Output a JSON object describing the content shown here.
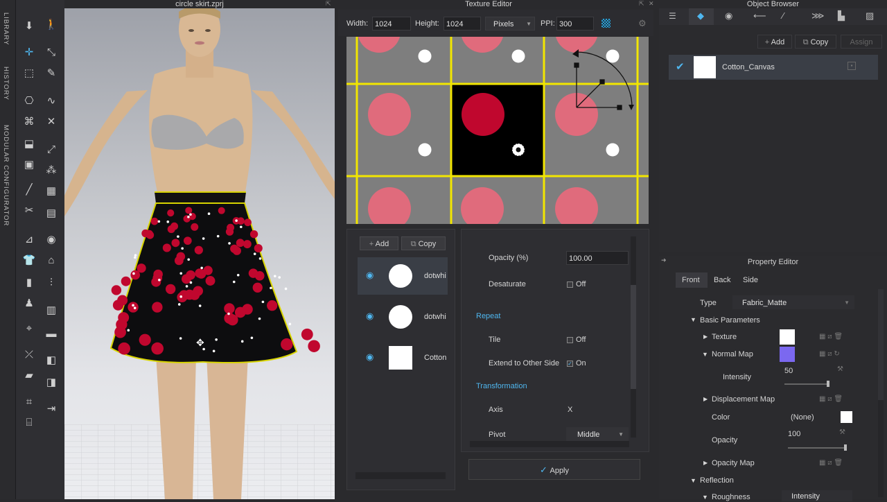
{
  "vertical_tabs": {
    "library": "LIBRARY",
    "history": "HISTORY",
    "modular": "MODULAR CONFIGURATOR"
  },
  "viewport": {
    "file_title": "circle skirt.zprj"
  },
  "texture_editor": {
    "title": "Texture Editor",
    "width_label": "Width:",
    "width_value": "1024",
    "height_label": "Height:",
    "height_value": "1024",
    "unit_value": "Pixels",
    "ppi_label": "PPI:",
    "ppi_value": "300",
    "layers_add": "Add",
    "layers_copy": "Copy",
    "layers": [
      {
        "name": "dotwhi"
      },
      {
        "name": "dotwhi"
      },
      {
        "name": "Cotton"
      }
    ],
    "opacity_label": "Opacity (%)",
    "opacity_value": "100.00",
    "desaturate_label": "Desaturate",
    "desaturate_value": "Off",
    "repeat_header": "Repeat",
    "tile_label": "Tile",
    "tile_value": "Off",
    "extend_label": "Extend to Other Side",
    "extend_value": "On",
    "transformation_header": "Transformation",
    "axis_label": "Axis",
    "axis_value": "X",
    "pivot_label": "Pivot",
    "pivot_value": "Middle",
    "apply_label": "Apply",
    "colors": {
      "pink": "#e06b7c",
      "red": "#c0072e",
      "grid": "#f2e600",
      "gray": "#7e7e7e"
    }
  },
  "object_browser": {
    "title": "Object Browser",
    "add": "Add",
    "copy": "Copy",
    "assign": "Assign",
    "item_name": "Cotton_Canvas"
  },
  "property_editor": {
    "title": "Property Editor",
    "tabs": [
      "Front",
      "Back",
      "Side"
    ],
    "type_label": "Type",
    "type_value": "Fabric_Matte",
    "basic_params": "Basic Parameters",
    "texture": "Texture",
    "normal_map": "Normal Map",
    "intensity_label": "Intensity",
    "intensity_value": "50",
    "displacement_map": "Displacement Map",
    "color_label": "Color",
    "color_value": "(None)",
    "opacity_label": "Opacity",
    "opacity_value": "100",
    "opacity_map": "Opacity Map",
    "reflection": "Reflection",
    "roughness": "Roughness",
    "roughness_value": "Intensity",
    "normal_map_color": "#7b68f0"
  }
}
